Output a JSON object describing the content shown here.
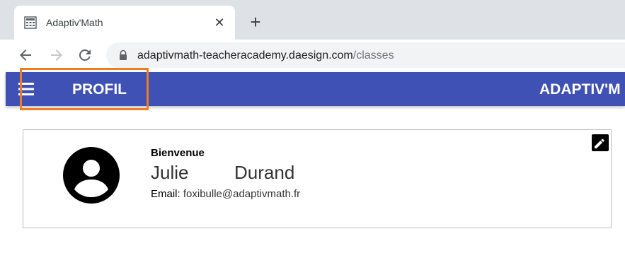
{
  "browser": {
    "tab": {
      "title": "Adaptiv'Math",
      "favicon": "calculator-icon",
      "close_icon": "close-icon"
    },
    "new_tab_icon": "plus-icon",
    "nav": {
      "back_icon": "arrow-left-icon",
      "forward_icon": "arrow-right-icon",
      "reload_icon": "reload-icon"
    },
    "address": {
      "lock_icon": "lock-icon",
      "host": "adaptivmath-teacheracademy.daesign.com",
      "path": "/classes"
    }
  },
  "appbar": {
    "background": "#3f51b5",
    "menu_icon": "hamburger-menu-icon",
    "title": "PROFIL",
    "brand": "ADAPTIV'M",
    "highlight_color": "#ef7d22"
  },
  "profile": {
    "avatar_icon": "account-circle-icon",
    "welcome": "Bienvenue",
    "first_name": "Julie",
    "last_name": "Durand",
    "email_label": "Email:",
    "email": "foxibulle@adaptivmath.fr",
    "edit_icon": "pencil-icon"
  }
}
